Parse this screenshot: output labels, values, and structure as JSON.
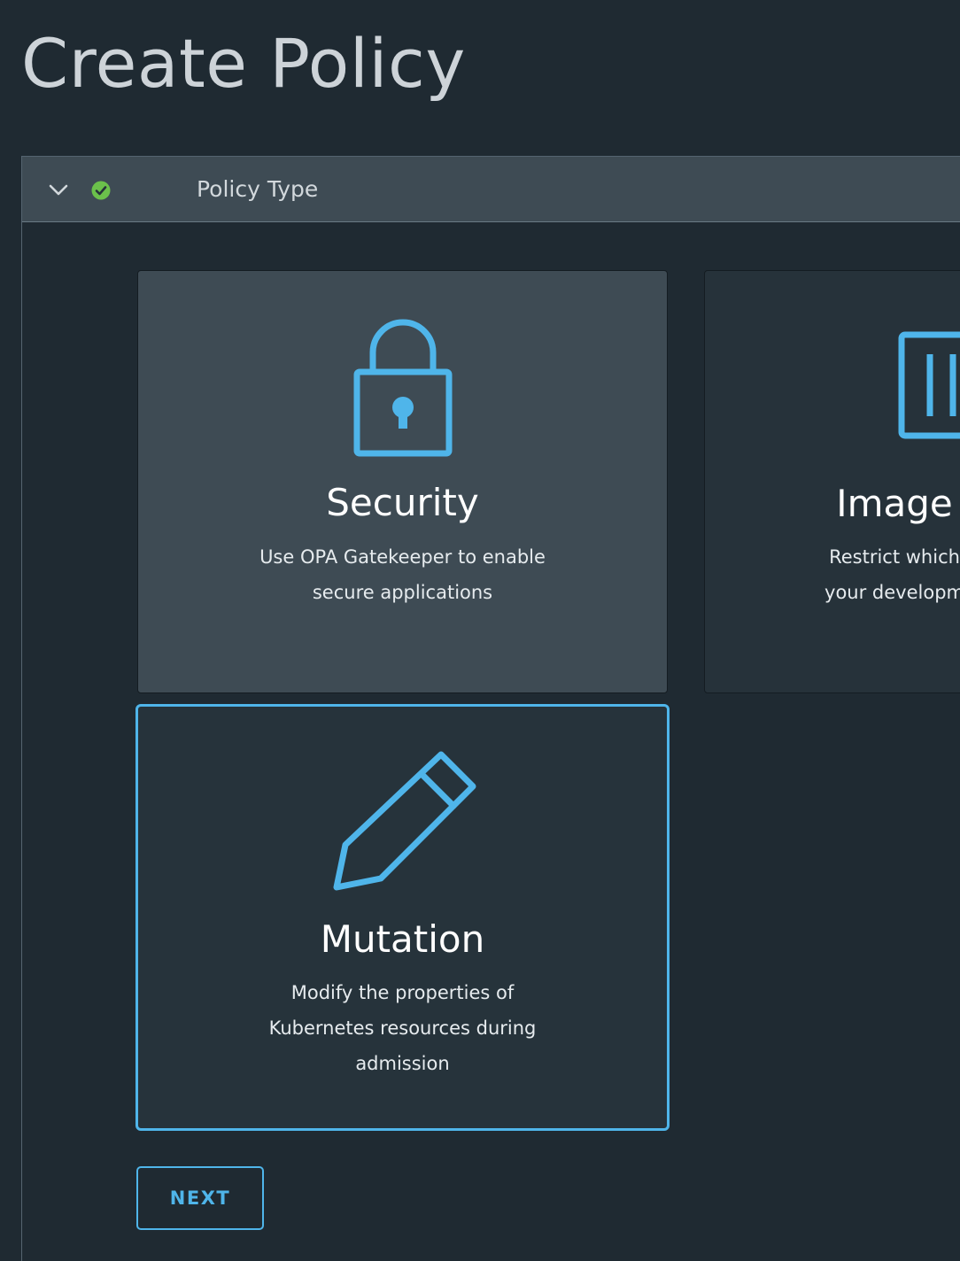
{
  "page": {
    "title": "Create Policy"
  },
  "panel": {
    "title": "Policy Type",
    "status": "complete",
    "status_color": "#6bc04b",
    "collapse_icon": "chevron-down-icon"
  },
  "cards": {
    "security": {
      "icon": "lock-icon",
      "title": "Security",
      "desc_line1": "Use OPA Gatekeeper to enable",
      "desc_line2": "secure applications",
      "selected": false
    },
    "image": {
      "icon": "image-registry-icon",
      "title": "Image",
      "desc_line1": "Restrict which",
      "desc_line2": "your developm",
      "selected": false
    },
    "mutation": {
      "icon": "pencil-icon",
      "title": "Mutation",
      "desc_line1": "Modify the properties of",
      "desc_line2": "Kubernetes resources during",
      "desc_line3": "admission",
      "selected": true
    }
  },
  "actions": {
    "next_label": "NEXT"
  },
  "colors": {
    "background": "#1f2a32",
    "header_bg": "#3e4b54",
    "accent": "#4fb5ea",
    "success": "#6bc04b"
  }
}
